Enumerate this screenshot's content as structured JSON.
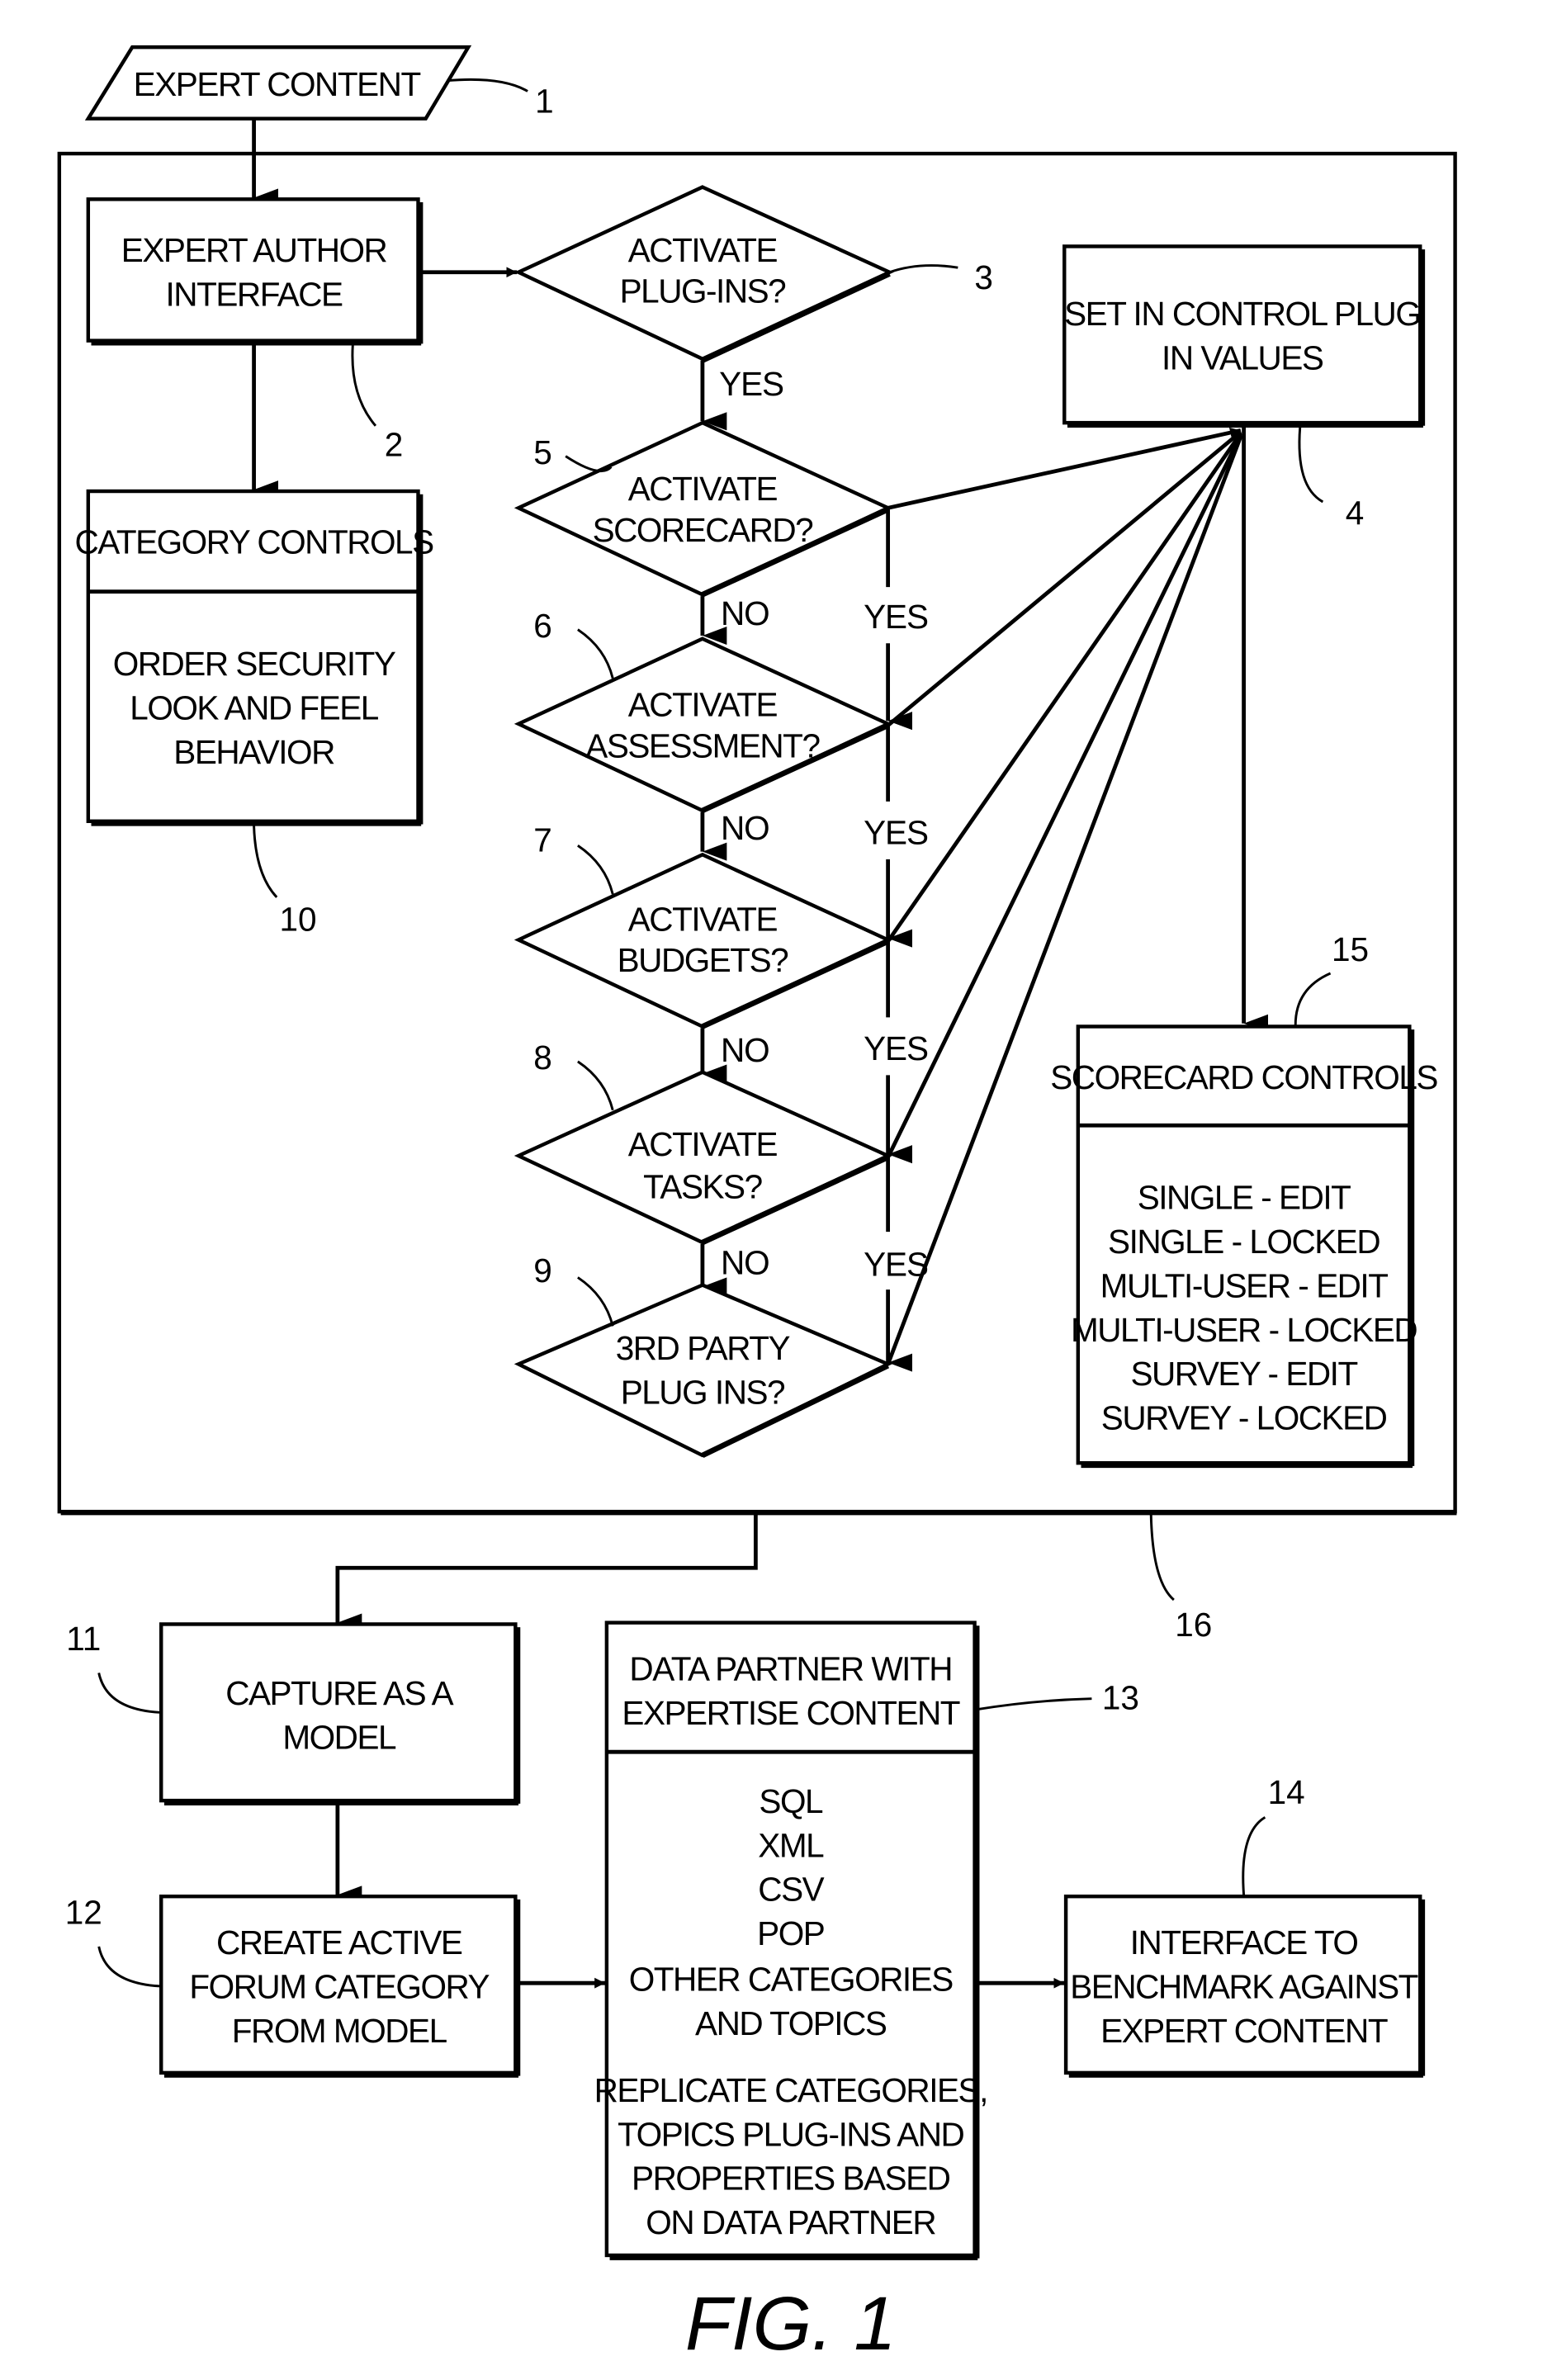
{
  "figure": {
    "caption": "FIG. 1",
    "container_ref": "16"
  },
  "nodes": {
    "expert_content": {
      "ref": "1",
      "lines": [
        "EXPERT CONTENT"
      ]
    },
    "expert_author_interface": {
      "ref": "2",
      "lines": [
        "EXPERT AUTHOR",
        "INTERFACE"
      ]
    },
    "activate_plugins": {
      "ref": "3",
      "lines": [
        "ACTIVATE",
        "PLUG-INS?"
      ]
    },
    "set_control_plugin_values": {
      "ref": "4",
      "lines": [
        "SET IN CONTROL PLUG",
        "IN VALUES"
      ]
    },
    "activate_scorecard": {
      "ref": "5",
      "lines": [
        "ACTIVATE",
        "SCORECARD?"
      ]
    },
    "activate_assessment": {
      "ref": "6",
      "lines": [
        "ACTIVATE",
        "ASSESSMENT?"
      ]
    },
    "activate_budgets": {
      "ref": "7",
      "lines": [
        "ACTIVATE",
        "BUDGETS?"
      ]
    },
    "activate_tasks": {
      "ref": "8",
      "lines": [
        "ACTIVATE",
        "TASKS?"
      ]
    },
    "third_party_plugins": {
      "ref": "9",
      "lines": [
        "3RD PARTY",
        "PLUG INS?"
      ]
    },
    "category_controls": {
      "ref": "10",
      "header": "CATEGORY CONTROLS",
      "lines": [
        "ORDER SECURITY",
        "LOOK AND FEEL",
        "BEHAVIOR"
      ]
    },
    "capture_as_model": {
      "ref": "11",
      "lines": [
        "CAPTURE AS A",
        "MODEL"
      ]
    },
    "create_forum_category": {
      "ref": "12",
      "lines": [
        "CREATE ACTIVE",
        "FORUM CATEGORY",
        "FROM MODEL"
      ]
    },
    "data_partner": {
      "ref": "13",
      "header": [
        "DATA PARTNER WITH",
        "EXPERTISE CONTENT"
      ],
      "lines": [
        "SQL",
        "XML",
        "CSV",
        "POP",
        "OTHER CATEGORIES",
        "AND TOPICS"
      ],
      "lines2": [
        "REPLICATE CATEGORIES,",
        "TOPICS PLUG-INS AND",
        "PROPERTIES BASED",
        "ON DATA PARTNER"
      ]
    },
    "benchmark_interface": {
      "ref": "14",
      "lines": [
        "INTERFACE TO",
        "BENCHMARK AGAINST",
        "EXPERT CONTENT"
      ]
    },
    "scorecard_controls": {
      "ref": "15",
      "header": "SCORECARD CONTROLS",
      "lines": [
        "SINGLE - EDIT",
        "SINGLE - LOCKED",
        "MULTI-USER - EDIT",
        "MULTI-USER - LOCKED",
        "SURVEY - EDIT",
        "SURVEY - LOCKED"
      ]
    }
  },
  "edge_labels": {
    "yes": "YES",
    "no": "NO"
  }
}
